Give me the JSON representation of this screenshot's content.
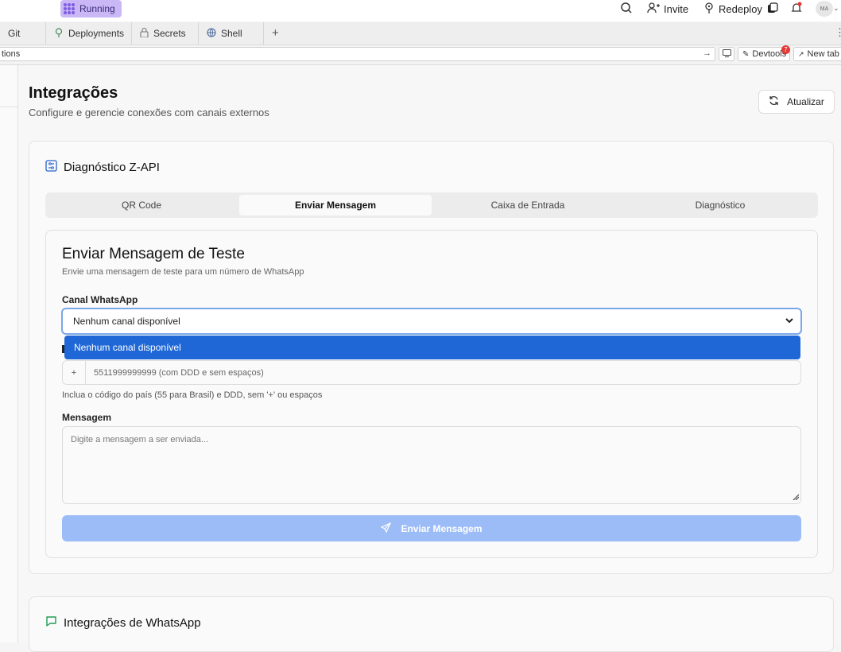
{
  "topbar": {
    "status": "Running",
    "invite": "Invite",
    "redeploy": "Redeploy",
    "avatar": "MA"
  },
  "tabs": [
    {
      "label": "Git",
      "icon": "git-icon"
    },
    {
      "label": "Deployments",
      "icon": "deployments-icon"
    },
    {
      "label": "Secrets",
      "icon": "lock-icon"
    },
    {
      "label": "Shell",
      "icon": "shell-icon"
    }
  ],
  "urlbar": {
    "url": "tions",
    "devtools": "Devtools",
    "devtools_badge": "7",
    "new_tab": "New tab"
  },
  "page": {
    "title": "Integrações",
    "subtitle": "Configure e gerencie conexões com canais externos",
    "refresh": "Atualizar"
  },
  "diag": {
    "title": "Diagnóstico Z-API",
    "tabs": [
      "QR Code",
      "Enviar Mensagem",
      "Caixa de Entrada",
      "Diagnóstico"
    ]
  },
  "form": {
    "title": "Enviar Mensagem de Teste",
    "description": "Envie uma mensagem de teste para um número de WhatsApp",
    "channel_label": "Canal WhatsApp",
    "channel_value": "Nenhum canal disponível",
    "channel_options": [
      "Nenhum canal disponível"
    ],
    "phone_prefix": "+",
    "phone_placeholder": "5511999999999 (com DDD e sem espaços)",
    "phone_hint": "Inclua o código do país (55 para Brasil) e DDD, sem '+' ou espaços",
    "message_label": "Mensagem",
    "message_placeholder": "Digite a mensagem a ser enviada...",
    "send": "Enviar Mensagem"
  },
  "whatsapp": {
    "title": "Integrações de WhatsApp"
  }
}
